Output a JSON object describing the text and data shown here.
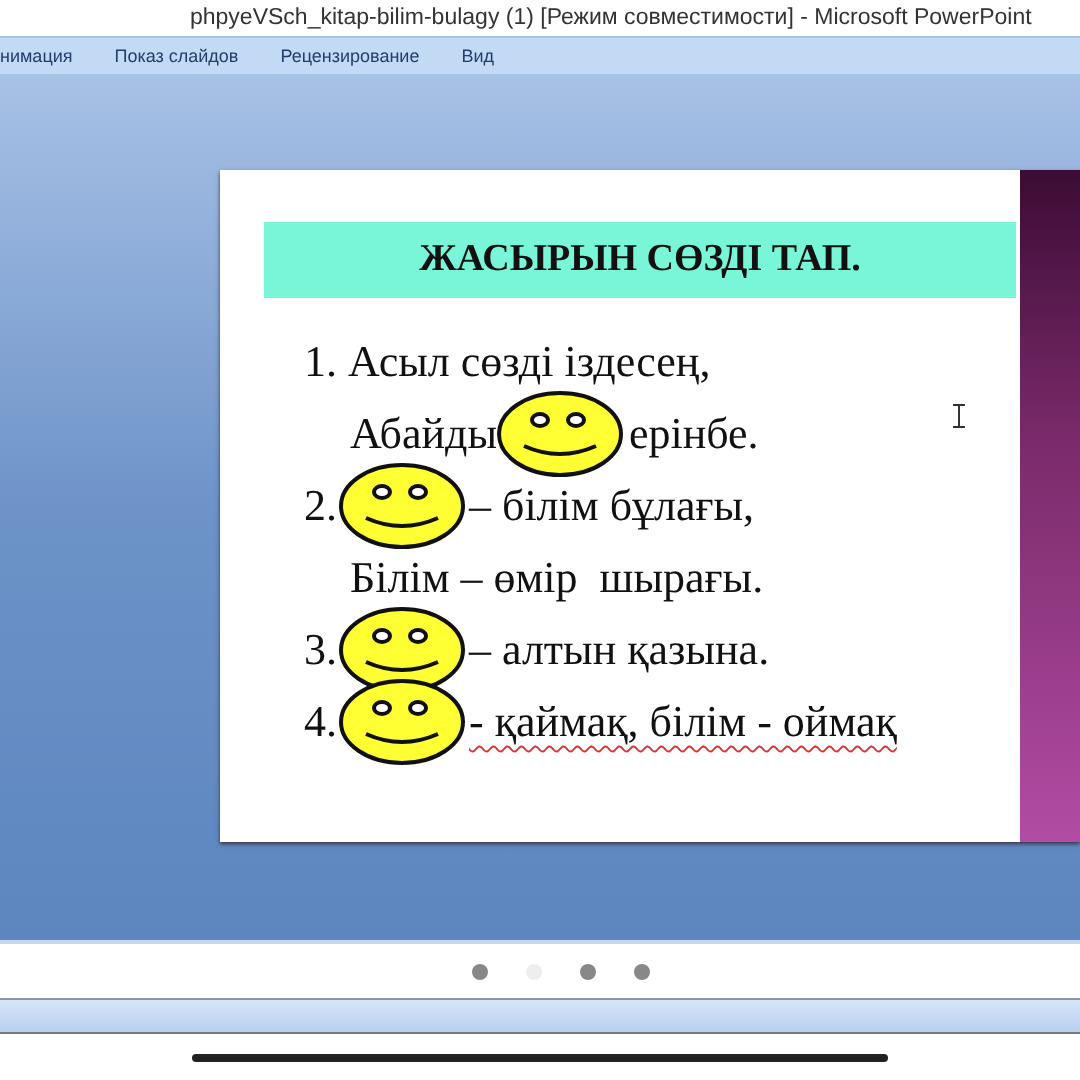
{
  "window": {
    "title": "phpyeVSch_kitap-bilim-bulagy (1) [Режим совместимости] - Microsoft PowerPoint"
  },
  "ribbon_tabs": [
    {
      "label": "нимация",
      "selected": false
    },
    {
      "label": "Показ слайдов",
      "selected": false
    },
    {
      "label": "Рецензирование",
      "selected": false
    },
    {
      "label": "Вид",
      "selected": false
    }
  ],
  "slide": {
    "heading": "ЖАСЫРЫН СӨЗДІ ТАП.",
    "lines": [
      {
        "kind": "item",
        "parts": [
          {
            "kind": "text",
            "text": "1. Асыл сөзді іздесең,"
          }
        ]
      },
      {
        "kind": "continuation",
        "parts": [
          {
            "kind": "text",
            "text": "Абайды"
          },
          {
            "kind": "smiley"
          },
          {
            "kind": "text",
            "text": "ерінбе."
          }
        ]
      },
      {
        "kind": "item",
        "parts": [
          {
            "kind": "text",
            "text": "2."
          },
          {
            "kind": "smiley"
          },
          {
            "kind": "text",
            "text": "– білім бұлағы,"
          }
        ]
      },
      {
        "kind": "continuation",
        "parts": [
          {
            "kind": "text",
            "text": "Білім – өмір  шырағы."
          }
        ]
      },
      {
        "kind": "item",
        "parts": [
          {
            "kind": "text",
            "text": "3."
          },
          {
            "kind": "smiley"
          },
          {
            "kind": "text",
            "text": "– алтын қазына."
          }
        ]
      },
      {
        "kind": "item",
        "parts": [
          {
            "kind": "text",
            "text": "4."
          },
          {
            "kind": "smiley"
          },
          {
            "kind": "text",
            "text": "- қаймақ, білім - оймақ",
            "misspelled": true
          }
        ]
      }
    ]
  },
  "pager": [
    {
      "selected": false
    },
    {
      "selected": true
    },
    {
      "selected": false
    },
    {
      "selected": false
    }
  ]
}
